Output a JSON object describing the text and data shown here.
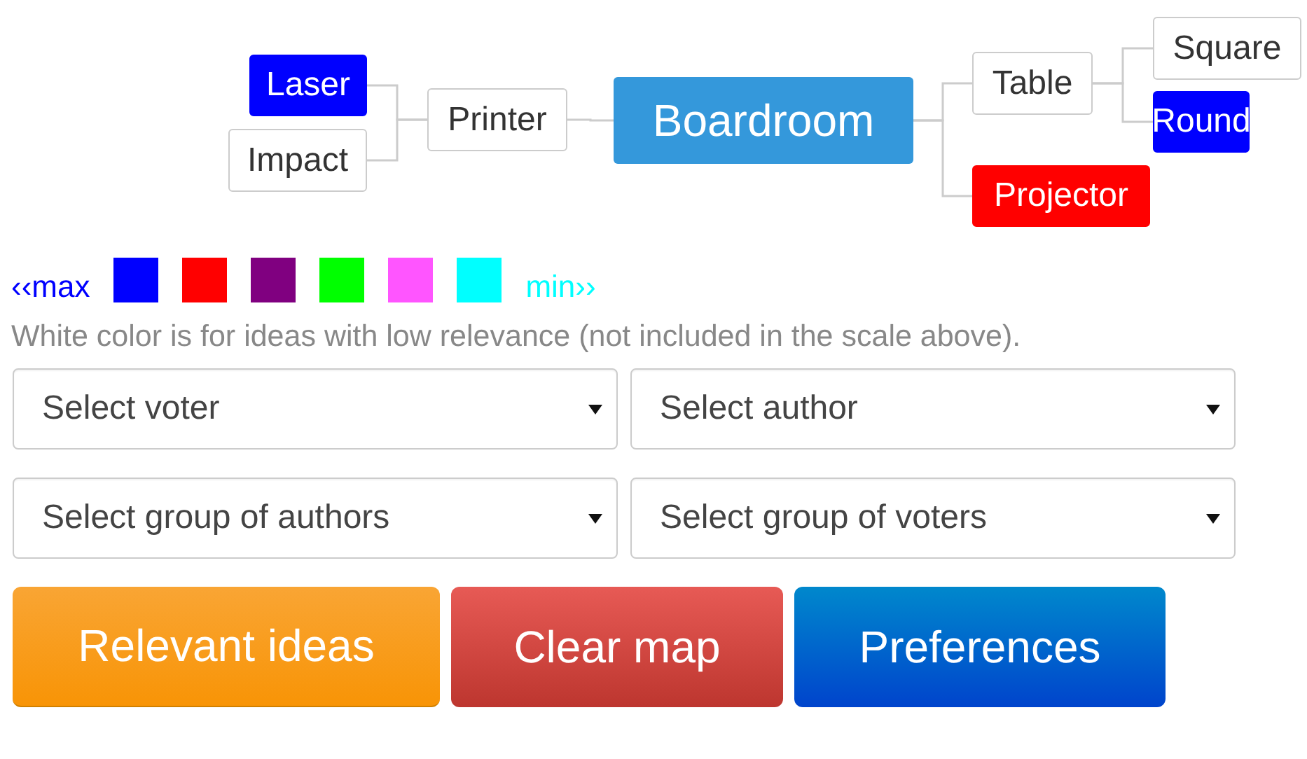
{
  "mind_map": {
    "root": {
      "label": "Boardroom",
      "color": "#3498db"
    },
    "left": [
      {
        "label": "Printer",
        "color": "#ffffff",
        "children": [
          {
            "label": "Laser",
            "color": "#0000ff"
          },
          {
            "label": "Impact",
            "color": "#ffffff"
          }
        ]
      }
    ],
    "right": [
      {
        "label": "Table",
        "color": "#ffffff",
        "children": [
          {
            "label": "Square",
            "color": "#ffffff"
          },
          {
            "label": "Round",
            "color": "#0000ff"
          }
        ]
      },
      {
        "label": "Projector",
        "color": "#ff0000"
      }
    ]
  },
  "legend": {
    "max_label": "‹‹max",
    "min_label": "min››",
    "swatches": [
      {
        "color": "#0000ff"
      },
      {
        "color": "#ff0000"
      },
      {
        "color": "#800080"
      },
      {
        "color": "#00ff00"
      },
      {
        "color": "#ff55ff"
      },
      {
        "color": "#00ffff"
      }
    ]
  },
  "note": "White color is for ideas with low relevance (not included in the scale above).",
  "selects": [
    {
      "placeholder": "Select voter"
    },
    {
      "placeholder": "Select author"
    },
    {
      "placeholder": "Select group of authors"
    },
    {
      "placeholder": "Select group of voters"
    }
  ],
  "buttons": [
    {
      "label": "Relevant ideas",
      "kind": "warning"
    },
    {
      "label": "Clear map",
      "kind": "danger"
    },
    {
      "label": "Preferences",
      "kind": "primary"
    }
  ]
}
